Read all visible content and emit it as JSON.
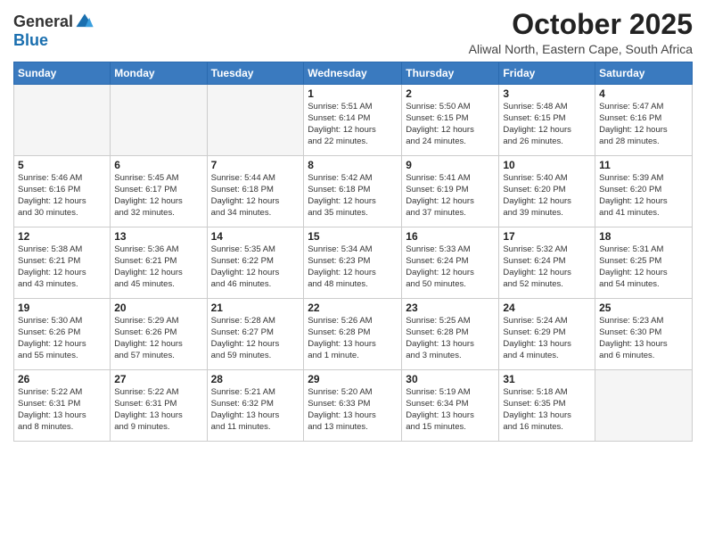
{
  "header": {
    "logo_line1": "General",
    "logo_line2": "Blue",
    "main_title": "October 2025",
    "subtitle": "Aliwal North, Eastern Cape, South Africa"
  },
  "calendar": {
    "days_of_week": [
      "Sunday",
      "Monday",
      "Tuesday",
      "Wednesday",
      "Thursday",
      "Friday",
      "Saturday"
    ],
    "weeks": [
      [
        {
          "day": "",
          "detail": ""
        },
        {
          "day": "",
          "detail": ""
        },
        {
          "day": "",
          "detail": ""
        },
        {
          "day": "1",
          "detail": "Sunrise: 5:51 AM\nSunset: 6:14 PM\nDaylight: 12 hours\nand 22 minutes."
        },
        {
          "day": "2",
          "detail": "Sunrise: 5:50 AM\nSunset: 6:15 PM\nDaylight: 12 hours\nand 24 minutes."
        },
        {
          "day": "3",
          "detail": "Sunrise: 5:48 AM\nSunset: 6:15 PM\nDaylight: 12 hours\nand 26 minutes."
        },
        {
          "day": "4",
          "detail": "Sunrise: 5:47 AM\nSunset: 6:16 PM\nDaylight: 12 hours\nand 28 minutes."
        }
      ],
      [
        {
          "day": "5",
          "detail": "Sunrise: 5:46 AM\nSunset: 6:16 PM\nDaylight: 12 hours\nand 30 minutes."
        },
        {
          "day": "6",
          "detail": "Sunrise: 5:45 AM\nSunset: 6:17 PM\nDaylight: 12 hours\nand 32 minutes."
        },
        {
          "day": "7",
          "detail": "Sunrise: 5:44 AM\nSunset: 6:18 PM\nDaylight: 12 hours\nand 34 minutes."
        },
        {
          "day": "8",
          "detail": "Sunrise: 5:42 AM\nSunset: 6:18 PM\nDaylight: 12 hours\nand 35 minutes."
        },
        {
          "day": "9",
          "detail": "Sunrise: 5:41 AM\nSunset: 6:19 PM\nDaylight: 12 hours\nand 37 minutes."
        },
        {
          "day": "10",
          "detail": "Sunrise: 5:40 AM\nSunset: 6:20 PM\nDaylight: 12 hours\nand 39 minutes."
        },
        {
          "day": "11",
          "detail": "Sunrise: 5:39 AM\nSunset: 6:20 PM\nDaylight: 12 hours\nand 41 minutes."
        }
      ],
      [
        {
          "day": "12",
          "detail": "Sunrise: 5:38 AM\nSunset: 6:21 PM\nDaylight: 12 hours\nand 43 minutes."
        },
        {
          "day": "13",
          "detail": "Sunrise: 5:36 AM\nSunset: 6:21 PM\nDaylight: 12 hours\nand 45 minutes."
        },
        {
          "day": "14",
          "detail": "Sunrise: 5:35 AM\nSunset: 6:22 PM\nDaylight: 12 hours\nand 46 minutes."
        },
        {
          "day": "15",
          "detail": "Sunrise: 5:34 AM\nSunset: 6:23 PM\nDaylight: 12 hours\nand 48 minutes."
        },
        {
          "day": "16",
          "detail": "Sunrise: 5:33 AM\nSunset: 6:24 PM\nDaylight: 12 hours\nand 50 minutes."
        },
        {
          "day": "17",
          "detail": "Sunrise: 5:32 AM\nSunset: 6:24 PM\nDaylight: 12 hours\nand 52 minutes."
        },
        {
          "day": "18",
          "detail": "Sunrise: 5:31 AM\nSunset: 6:25 PM\nDaylight: 12 hours\nand 54 minutes."
        }
      ],
      [
        {
          "day": "19",
          "detail": "Sunrise: 5:30 AM\nSunset: 6:26 PM\nDaylight: 12 hours\nand 55 minutes."
        },
        {
          "day": "20",
          "detail": "Sunrise: 5:29 AM\nSunset: 6:26 PM\nDaylight: 12 hours\nand 57 minutes."
        },
        {
          "day": "21",
          "detail": "Sunrise: 5:28 AM\nSunset: 6:27 PM\nDaylight: 12 hours\nand 59 minutes."
        },
        {
          "day": "22",
          "detail": "Sunrise: 5:26 AM\nSunset: 6:28 PM\nDaylight: 13 hours\nand 1 minute."
        },
        {
          "day": "23",
          "detail": "Sunrise: 5:25 AM\nSunset: 6:28 PM\nDaylight: 13 hours\nand 3 minutes."
        },
        {
          "day": "24",
          "detail": "Sunrise: 5:24 AM\nSunset: 6:29 PM\nDaylight: 13 hours\nand 4 minutes."
        },
        {
          "day": "25",
          "detail": "Sunrise: 5:23 AM\nSunset: 6:30 PM\nDaylight: 13 hours\nand 6 minutes."
        }
      ],
      [
        {
          "day": "26",
          "detail": "Sunrise: 5:22 AM\nSunset: 6:31 PM\nDaylight: 13 hours\nand 8 minutes."
        },
        {
          "day": "27",
          "detail": "Sunrise: 5:22 AM\nSunset: 6:31 PM\nDaylight: 13 hours\nand 9 minutes."
        },
        {
          "day": "28",
          "detail": "Sunrise: 5:21 AM\nSunset: 6:32 PM\nDaylight: 13 hours\nand 11 minutes."
        },
        {
          "day": "29",
          "detail": "Sunrise: 5:20 AM\nSunset: 6:33 PM\nDaylight: 13 hours\nand 13 minutes."
        },
        {
          "day": "30",
          "detail": "Sunrise: 5:19 AM\nSunset: 6:34 PM\nDaylight: 13 hours\nand 15 minutes."
        },
        {
          "day": "31",
          "detail": "Sunrise: 5:18 AM\nSunset: 6:35 PM\nDaylight: 13 hours\nand 16 minutes."
        },
        {
          "day": "",
          "detail": ""
        }
      ]
    ]
  }
}
